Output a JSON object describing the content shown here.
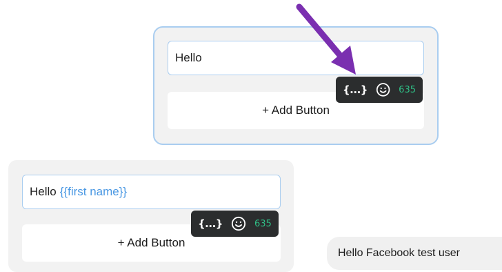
{
  "top_editor": {
    "message_text": "Hello",
    "add_button_label": "+ Add Button",
    "toolbar": {
      "variable_icon": "{...}",
      "emoji_icon": "smiley-face",
      "char_count": "635"
    }
  },
  "bottom_editor": {
    "message_text": "Hello",
    "variable_token": "{{first name}}",
    "add_button_label": "+ Add Button",
    "toolbar": {
      "variable_icon": "{...}",
      "emoji_icon": "smiley-face",
      "char_count": "635"
    }
  },
  "preview": {
    "message": "Hello Facebook test user"
  },
  "colors": {
    "accent_border": "#a9cdf0",
    "variable_text": "#4a98e3",
    "toolbar_bg": "#2b2d2e",
    "count_green": "#2fbf86",
    "arrow_purple": "#7a2fb0"
  }
}
